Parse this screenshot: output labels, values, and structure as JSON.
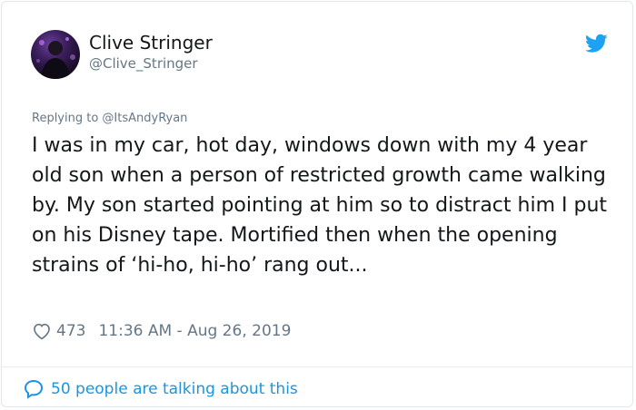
{
  "tweet": {
    "display_name": "Clive Stringer",
    "handle": "@Clive_Stringer",
    "reply_to": "Replying to @ItsAndyRyan",
    "text": "I was in my car, hot day, windows down with my 4 year old son when a person of restricted growth came walking by. My son started pointing at him so to distract him I put on his Disney tape. Mortified then when the opening strains of ‘hi-ho, hi-ho’ rang out...",
    "likes": "473",
    "timestamp": "11:36 AM - Aug 26, 2019",
    "talking": "50 people are talking about this"
  },
  "icons": {
    "brand": "twitter-bird-icon",
    "like": "heart-icon",
    "conversation": "speech-bubble-icon"
  },
  "colors": {
    "brand_blue": "#1da1f2",
    "link_blue": "#1b95e0",
    "text": "#14171a",
    "secondary": "#657786"
  }
}
